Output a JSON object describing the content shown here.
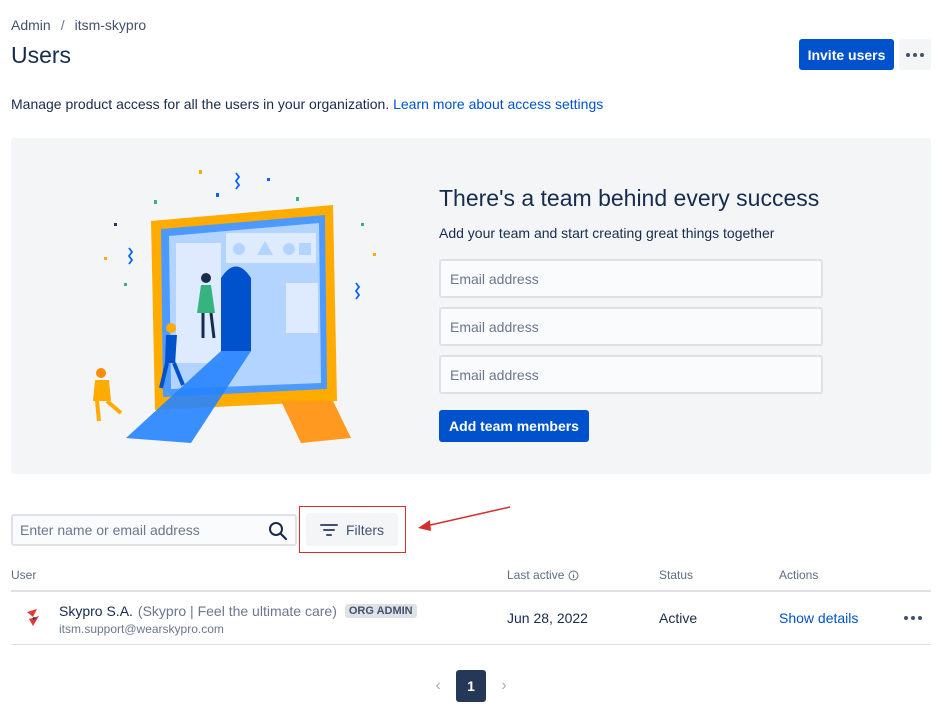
{
  "breadcrumb": {
    "items": [
      "Admin",
      "itsm-skypro"
    ],
    "separator": "/"
  },
  "page": {
    "title": "Users"
  },
  "header_actions": {
    "invite_label": "Invite users"
  },
  "description": {
    "text": "Manage product access for all the users in your organization.",
    "link": "Learn more about access settings"
  },
  "banner": {
    "title": "There's a team behind every success",
    "subtitle": "Add your team and start creating great things together",
    "email_placeholders": [
      "Email address",
      "Email address",
      "Email address"
    ],
    "add_button": "Add team members"
  },
  "search": {
    "placeholder": "Enter name or email address"
  },
  "filters": {
    "label": "Filters"
  },
  "table": {
    "columns": [
      "User",
      "Last active",
      "Status",
      "Actions"
    ],
    "rows": [
      {
        "name": "Skypro S.A.",
        "nickname": "(Skypro | Feel the ultimate care)",
        "badge": "ORG ADMIN",
        "email": "itsm.support@wearskypro.com",
        "last_active": "Jun 28, 2022",
        "status": "Active",
        "action": "Show details"
      }
    ]
  },
  "pagination": {
    "current": "1"
  },
  "colors": {
    "primary": "#0052cc",
    "text": "#172b4d",
    "muted": "#6b778c",
    "highlight": "#d32f2f"
  }
}
